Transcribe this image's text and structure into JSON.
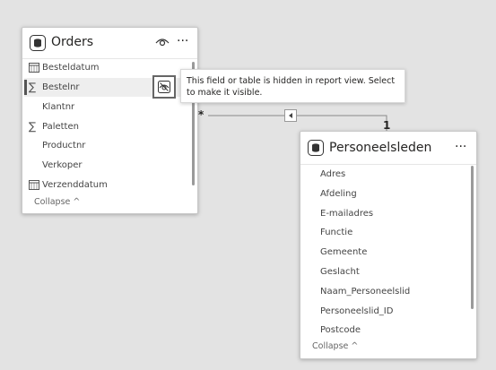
{
  "orders": {
    "title": "Orders",
    "more": "···",
    "fields": [
      {
        "label": "Besteldatum",
        "icon": "calendar-icon"
      },
      {
        "label": "Bestelnr",
        "icon": "sigma-icon"
      },
      {
        "label": "Klantnr",
        "icon": ""
      },
      {
        "label": "Paletten",
        "icon": "sigma-icon"
      },
      {
        "label": "Productnr",
        "icon": ""
      },
      {
        "label": "Verkoper",
        "icon": ""
      },
      {
        "label": "Verzenddatum",
        "icon": "calendar-icon"
      }
    ],
    "collapse": "Collapse ^"
  },
  "tooltip": {
    "text": "This field or table is hidden in report view. Select to make it visible."
  },
  "relationship": {
    "many": "*",
    "one": "1"
  },
  "personeelsleden": {
    "title": "Personeelsleden",
    "more": "···",
    "fields": [
      "Adres",
      "Afdeling",
      "E-mailadres",
      "Functie",
      "Gemeente",
      "Geslacht",
      "Naam_Personeelslid",
      "Personeelslid_ID",
      "Postcode"
    ],
    "collapse": "Collapse ^"
  }
}
